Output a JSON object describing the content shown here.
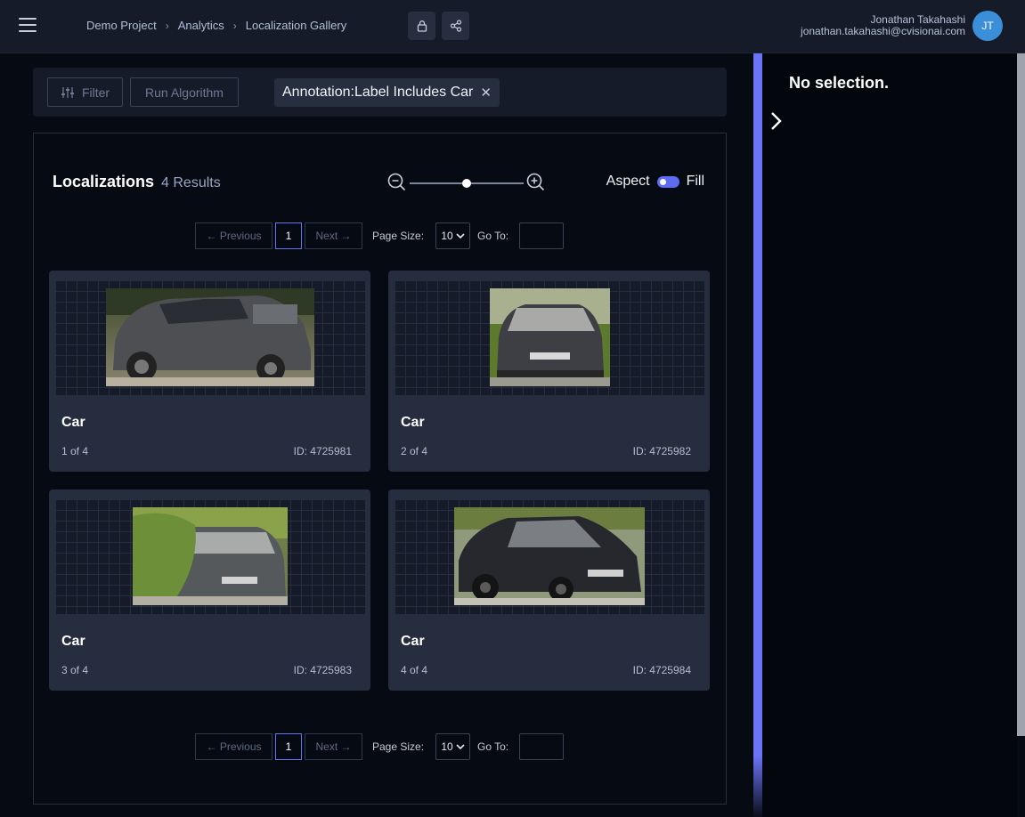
{
  "header": {
    "breadcrumbs": [
      "Demo Project",
      "Analytics",
      "Localization Gallery"
    ],
    "user_name": "Jonathan Takahashi",
    "user_email": "jonathan.takahashi@cvisionai.com",
    "avatar_initials": "JT",
    "icons": [
      "menu-icon",
      "lock-icon",
      "share-icon"
    ]
  },
  "filterbar": {
    "filter_label": "Filter",
    "run_label": "Run Algorithm",
    "chip_label": "Annotation:Label Includes Car",
    "chip_close": "✕"
  },
  "gallery": {
    "title": "Localizations",
    "count": "4 Results",
    "aspect_label": "Aspect",
    "fill_label": "Fill",
    "zoom_level": 0.5
  },
  "pager": {
    "previous": "← Previous",
    "current_page": "1",
    "next": "Next →",
    "page_size_label": "Page Size:",
    "page_size": "10",
    "goto_label": "Go To:",
    "goto_value": ""
  },
  "cards": [
    {
      "label": "Car",
      "index": "1 of 4",
      "id": "ID: 4725981"
    },
    {
      "label": "Car",
      "index": "2 of 4",
      "id": "ID: 4725982"
    },
    {
      "label": "Car",
      "index": "3 of 4",
      "id": "ID: 4725983"
    },
    {
      "label": "Car",
      "index": "4 of 4",
      "id": "ID: 4725984"
    }
  ],
  "side": {
    "no_selection": "No selection."
  },
  "colors": {
    "accent": "#6b74f5",
    "toggle": "#5e6cf2",
    "avatar": "#3b8fd9",
    "card_bg": "#262d3e"
  }
}
